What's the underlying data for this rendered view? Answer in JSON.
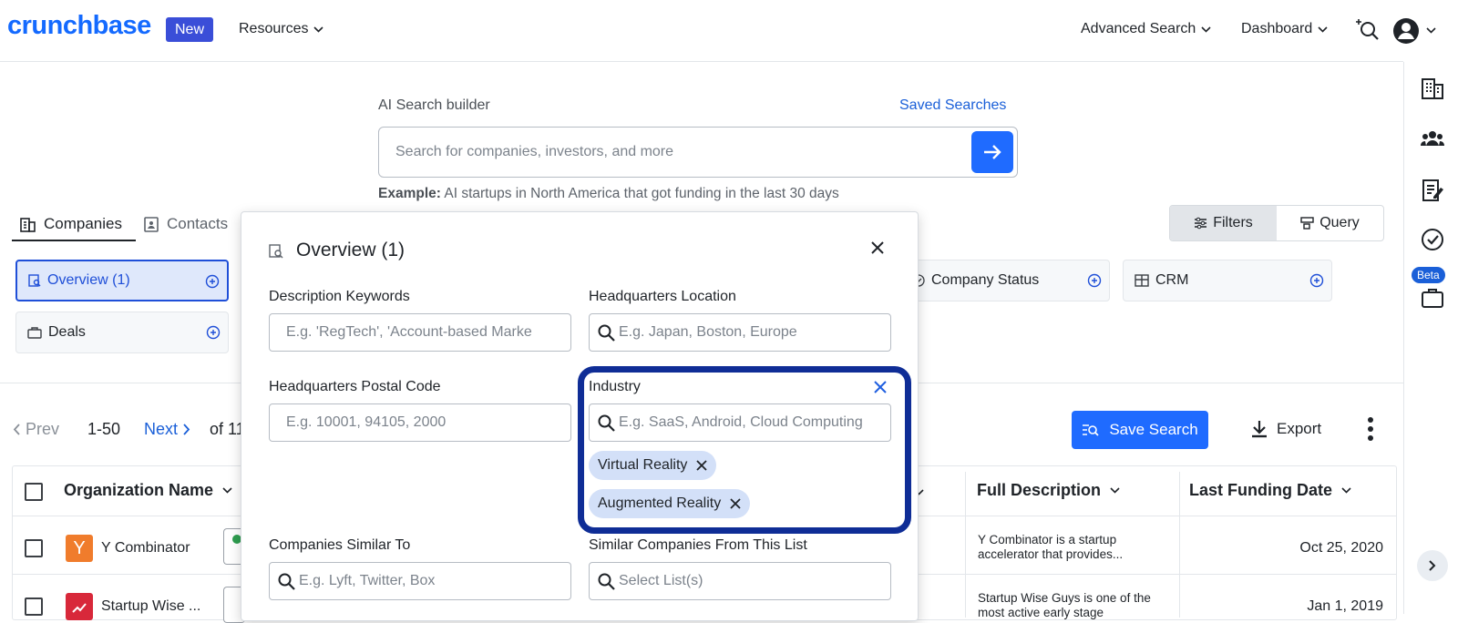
{
  "header": {
    "logo": "crunchbase",
    "new_badge": "New",
    "resources": "Resources",
    "advanced_search": "Advanced Search",
    "dashboard": "Dashboard"
  },
  "rail": {
    "beta": "Beta"
  },
  "search": {
    "label": "AI Search builder",
    "saved_searches": "Saved Searches",
    "placeholder": "Search for companies, investors, and more",
    "example_prefix": "Example:",
    "example_text": "AI startups in North America that got funding in the last 30 days"
  },
  "tabs": [
    {
      "label": "Companies"
    },
    {
      "label": "Contacts"
    }
  ],
  "view_toggle": {
    "filters": "Filters",
    "query": "Query"
  },
  "filter_chips": {
    "overview": "Overview (1)",
    "deals": "Deals",
    "company_status": "Company Status",
    "crm": "CRM"
  },
  "pagination": {
    "prev": "Prev",
    "range": "1-50",
    "next": "Next",
    "of": "of 11"
  },
  "actions": {
    "save_search": "Save Search",
    "export": "Export"
  },
  "table": {
    "columns": {
      "organization_name": "Organization Name",
      "full_description": "Full Description",
      "last_funding_date": "Last Funding Date"
    },
    "rows": [
      {
        "logo_letter": "Y",
        "name": "Y Combinator",
        "description": "Y Combinator is a startup accelerator that provides...",
        "date": "Oct 25, 2020"
      },
      {
        "logo_letter": "",
        "name": "Startup Wise ...",
        "description": "Startup Wise Guys is one of the most active early stage",
        "date": "Jan 1, 2019"
      }
    ]
  },
  "panel": {
    "title": "Overview (1)",
    "description_keywords": {
      "label": "Description Keywords",
      "placeholder": "E.g. 'RegTech', 'Account-based Marke"
    },
    "hq_location": {
      "label": "Headquarters Location",
      "placeholder": "E.g. Japan, Boston, Europe"
    },
    "hq_postal": {
      "label": "Headquarters Postal Code",
      "placeholder": "E.g. 10001, 94105, 2000"
    },
    "industry": {
      "label": "Industry",
      "placeholder": "E.g. SaaS, Android, Cloud Computing",
      "tags": [
        "Virtual Reality",
        "Augmented Reality"
      ]
    },
    "similar_to": {
      "label": "Companies Similar To",
      "placeholder": "E.g. Lyft, Twitter, Box"
    },
    "similar_list": {
      "label": "Similar Companies From This List",
      "placeholder": "Select List(s)"
    }
  },
  "colors": {
    "brand": "#146aff",
    "accent": "#1f6bff",
    "highlight": "#0f2d96"
  }
}
